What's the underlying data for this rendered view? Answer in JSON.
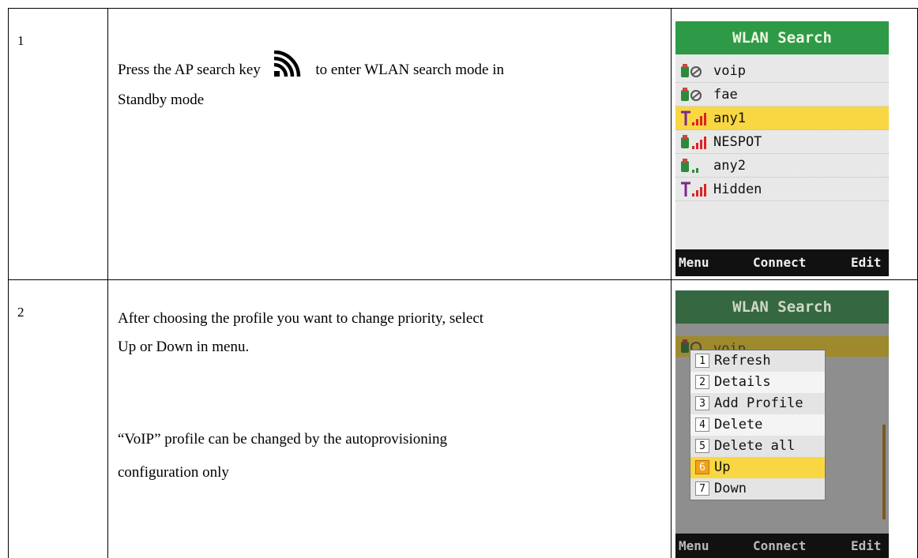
{
  "rows": [
    {
      "number": "1",
      "text_before_icon": "Press the AP search key",
      "text_after_icon": "to enter WLAN search mode in",
      "text_line2": "Standby mode",
      "key_icon": "wifi-signal-icon"
    },
    {
      "number": "2",
      "text_p1_line1": "After choosing the profile you want to change priority, select",
      "text_p1_line2": "Up or Down in menu.",
      "text_p2_line1": "“VoIP” profile can be changed by the autoprovisioning",
      "text_p2_line2": "configuration only"
    }
  ],
  "screen1": {
    "title": "WLAN Search",
    "items": [
      {
        "label": "voip",
        "icon": "locked-network-icon",
        "selected": false
      },
      {
        "label": "fae",
        "icon": "locked-network-icon",
        "selected": false
      },
      {
        "label": "any1",
        "icon": "open-network-signal-icon",
        "selected": true
      },
      {
        "label": "NESPOT",
        "icon": "secure-network-signal-icon",
        "selected": false
      },
      {
        "label": "any2",
        "icon": "secure-network-weak-icon",
        "selected": false
      },
      {
        "label": "Hidden",
        "icon": "open-network-signal-icon",
        "selected": false
      }
    ],
    "softkeys": {
      "left": "Menu",
      "center": "Connect",
      "right": "Edit"
    }
  },
  "screen2": {
    "title": "WLAN Search",
    "first_item": "voip",
    "menu": [
      {
        "num": "1",
        "label": "Refresh",
        "selected": false
      },
      {
        "num": "2",
        "label": "Details",
        "selected": false
      },
      {
        "num": "3",
        "label": "Add Profile",
        "selected": false
      },
      {
        "num": "4",
        "label": "Delete",
        "selected": false
      },
      {
        "num": "5",
        "label": "Delete all",
        "selected": false
      },
      {
        "num": "6",
        "label": "Up",
        "selected": true
      },
      {
        "num": "7",
        "label": "Down",
        "selected": false
      }
    ],
    "softkeys": {
      "left": "Menu",
      "center": "Connect",
      "right": "Edit"
    }
  },
  "colors": {
    "title_bar": "#2e9a48",
    "highlight": "#f8d742",
    "softbar": "#111111",
    "menu_num_selected": "#f2a01e"
  }
}
